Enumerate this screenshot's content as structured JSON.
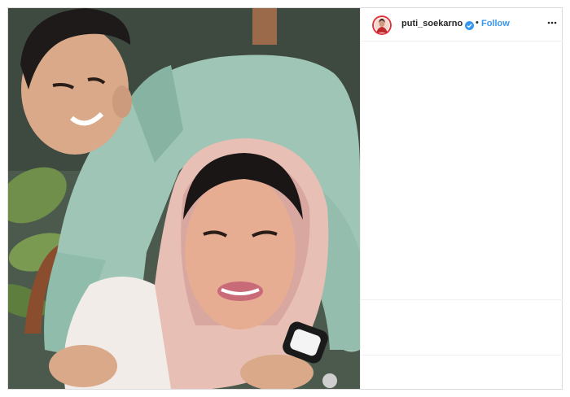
{
  "header": {
    "username": "puti_soekarno",
    "separator": "•",
    "follow_label": "Follow"
  },
  "icons": {
    "verified": "verified-badge-icon",
    "more": "more-options-icon"
  },
  "colors": {
    "follow": "#3897f0",
    "verified": "#3897f0",
    "border": "#dbdbdb",
    "avatar_ring": "#e0303a"
  }
}
